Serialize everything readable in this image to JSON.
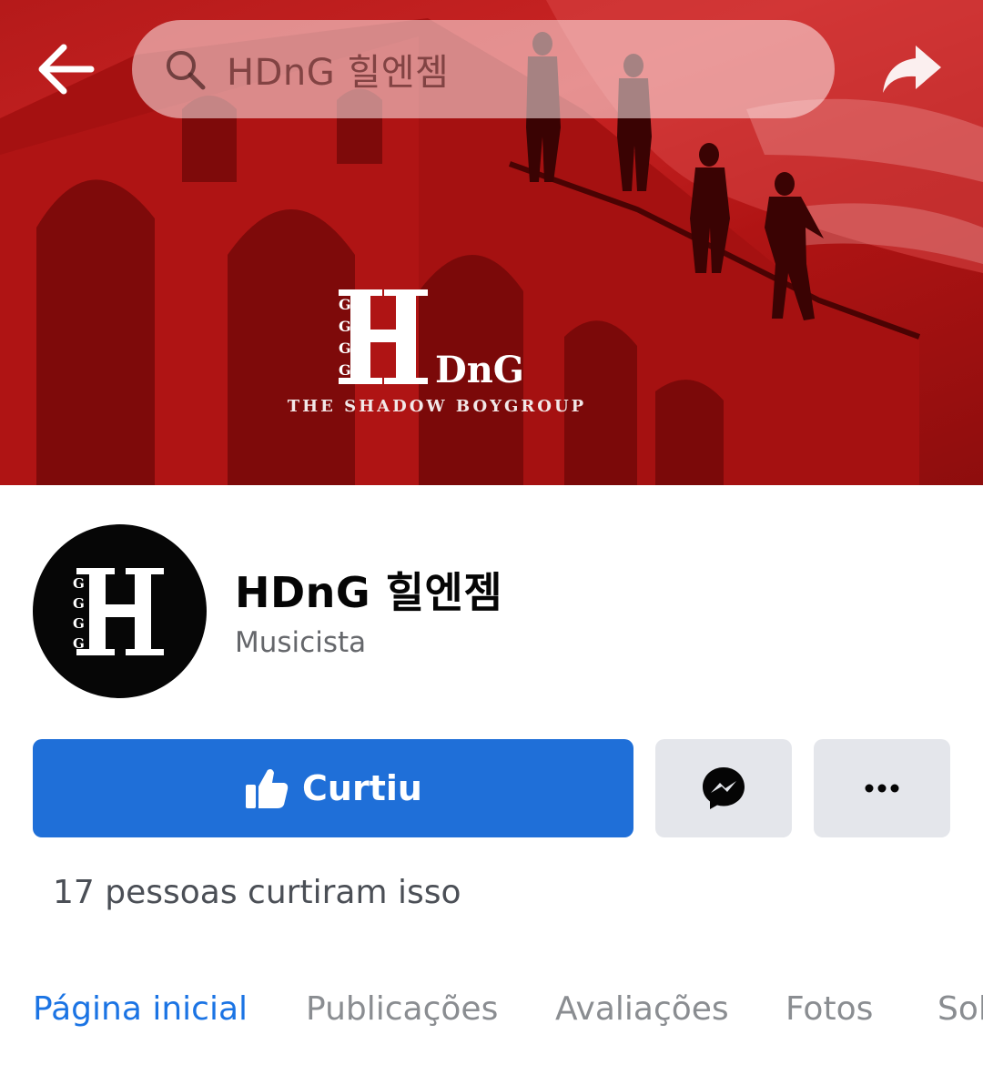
{
  "header": {
    "search_text": "HDnG 힐엔젬",
    "icons": [
      "back-arrow-icon",
      "search-icon",
      "share-icon"
    ]
  },
  "cover": {
    "logo_text": "DnG",
    "tagline": "THE SHADOW BOYGROUP"
  },
  "profile": {
    "name": "HDnG 힐엔젬",
    "category": "Musicista"
  },
  "actions": {
    "like_label": "Curtiu",
    "likes_text": "17 pessoas curtiram isso",
    "icons": [
      "thumbs-up-icon",
      "messenger-icon",
      "more-icon"
    ]
  },
  "tabs": [
    {
      "label": "Página inicial",
      "active": true
    },
    {
      "label": "Publicações",
      "active": false
    },
    {
      "label": "Avaliações",
      "active": false
    },
    {
      "label": "Fotos",
      "active": false
    },
    {
      "label": "Sol",
      "active": false
    }
  ],
  "colors": {
    "cover_red": "#c62020",
    "primary_blue": "#1f6fd8",
    "active_tab": "#1b74e4",
    "secondary_button": "#e4e6eb"
  }
}
